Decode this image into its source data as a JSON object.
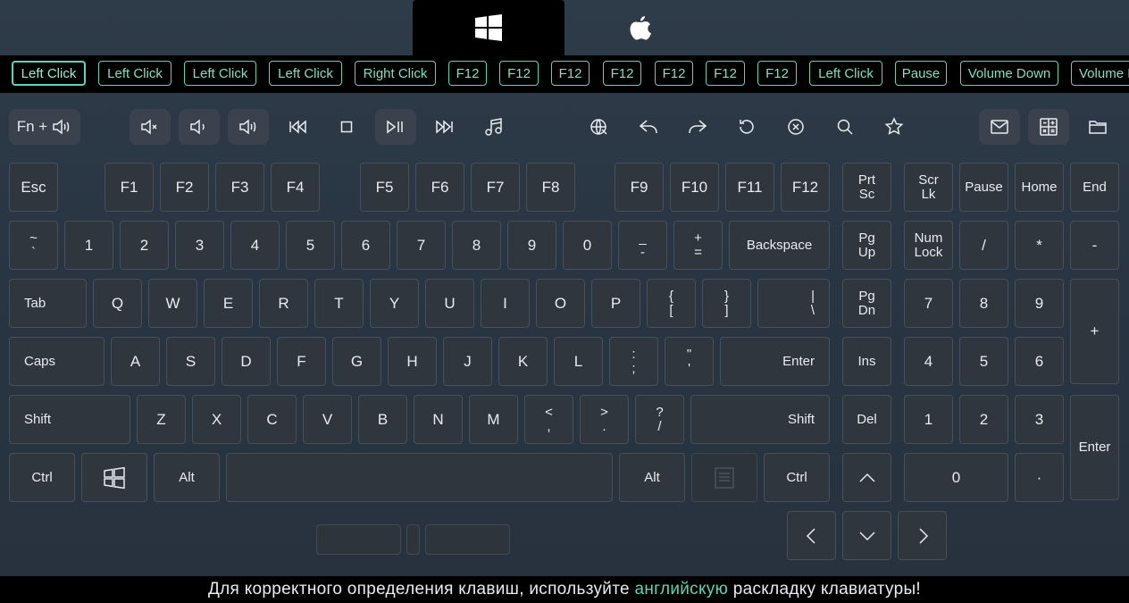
{
  "os_tabs": {
    "windows": "windows-logo",
    "mac": "apple-logo"
  },
  "chips": [
    "Left Click",
    "Left Click",
    "Left Click",
    "Left Click",
    "Right Click",
    "F12",
    "F12",
    "F12",
    "F12",
    "F12",
    "F12",
    "F12",
    "Left Click",
    "Pause",
    "Volume Down",
    "Volume M"
  ],
  "media": {
    "fn_label": "Fn +"
  },
  "keys": {
    "esc": "Esc",
    "f1": "F1",
    "f2": "F2",
    "f3": "F3",
    "f4": "F4",
    "f5": "F5",
    "f6": "F6",
    "f7": "F7",
    "f8": "F8",
    "f9": "F9",
    "f10": "F10",
    "f11": "F11",
    "f12": "F12",
    "prtsc_1": "Prt",
    "prtsc_2": "Sc",
    "scrlk_1": "Scr",
    "scrlk_2": "Lk",
    "pause": "Pause",
    "home": "Home",
    "end": "End",
    "tilde_top": "~",
    "tilde_bot": "`",
    "n1": "1",
    "n2": "2",
    "n3": "3",
    "n4": "4",
    "n5": "5",
    "n6": "6",
    "n7": "7",
    "n8": "8",
    "n9": "9",
    "n0": "0",
    "minus_top": "_",
    "minus_bot": "-",
    "plus_top": "+",
    "plus_bot": "=",
    "backspace": "Backspace",
    "pgup_1": "Pg",
    "pgup_2": "Up",
    "numlock_1": "Num",
    "numlock_2": "Lock",
    "np_div": "/",
    "np_mul": "*",
    "np_sub": "-",
    "tab": "Tab",
    "q": "Q",
    "w": "W",
    "e": "E",
    "r": "R",
    "t": "T",
    "y": "Y",
    "u": "U",
    "i": "I",
    "o": "O",
    "p": "P",
    "lbrace_top": "{",
    "lbrace_bot": "[",
    "rbrace_top": "}",
    "rbrace_bot": "]",
    "pipe_top": "|",
    "pipe_bot": "\\",
    "pgdn_1": "Pg",
    "pgdn_2": "Dn",
    "np7": "7",
    "np8": "8",
    "np9": "9",
    "np_add": "+",
    "caps": "Caps",
    "a": "A",
    "s": "S",
    "d": "D",
    "f": "F",
    "g": "G",
    "h": "H",
    "j": "J",
    "k": "K",
    "l": "L",
    "colon_top": ":",
    "colon_bot": ";",
    "quote_top": "\"",
    "quote_bot": "'",
    "enter": "Enter",
    "ins": "Ins",
    "np4": "4",
    "np5": "5",
    "np6": "6",
    "lshift": "Shift",
    "z": "Z",
    "x": "X",
    "c": "C",
    "v": "V",
    "b": "B",
    "n": "N",
    "m": "M",
    "lt_top": "<",
    "lt_bot": ",",
    "gt_top": ">",
    "gt_bot": ".",
    "q_top": "?",
    "q_bot": "/",
    "rshift": "Shift",
    "del": "Del",
    "np1": "1",
    "np2": "2",
    "np3": "3",
    "np_enter": "Enter",
    "lctrl": "Ctrl",
    "lalt": "Alt",
    "ralt": "Alt",
    "rctrl": "Ctrl",
    "np0": "0",
    "np_dot": "·"
  },
  "footer": {
    "before": "Для корректного определения клавиш, используйте",
    "highlight": "английскую",
    "after": "раскладку клавиатуры!"
  },
  "colors": {
    "accent": "#5fd3b3",
    "background": "#2a3744",
    "key": "#2f363e"
  }
}
